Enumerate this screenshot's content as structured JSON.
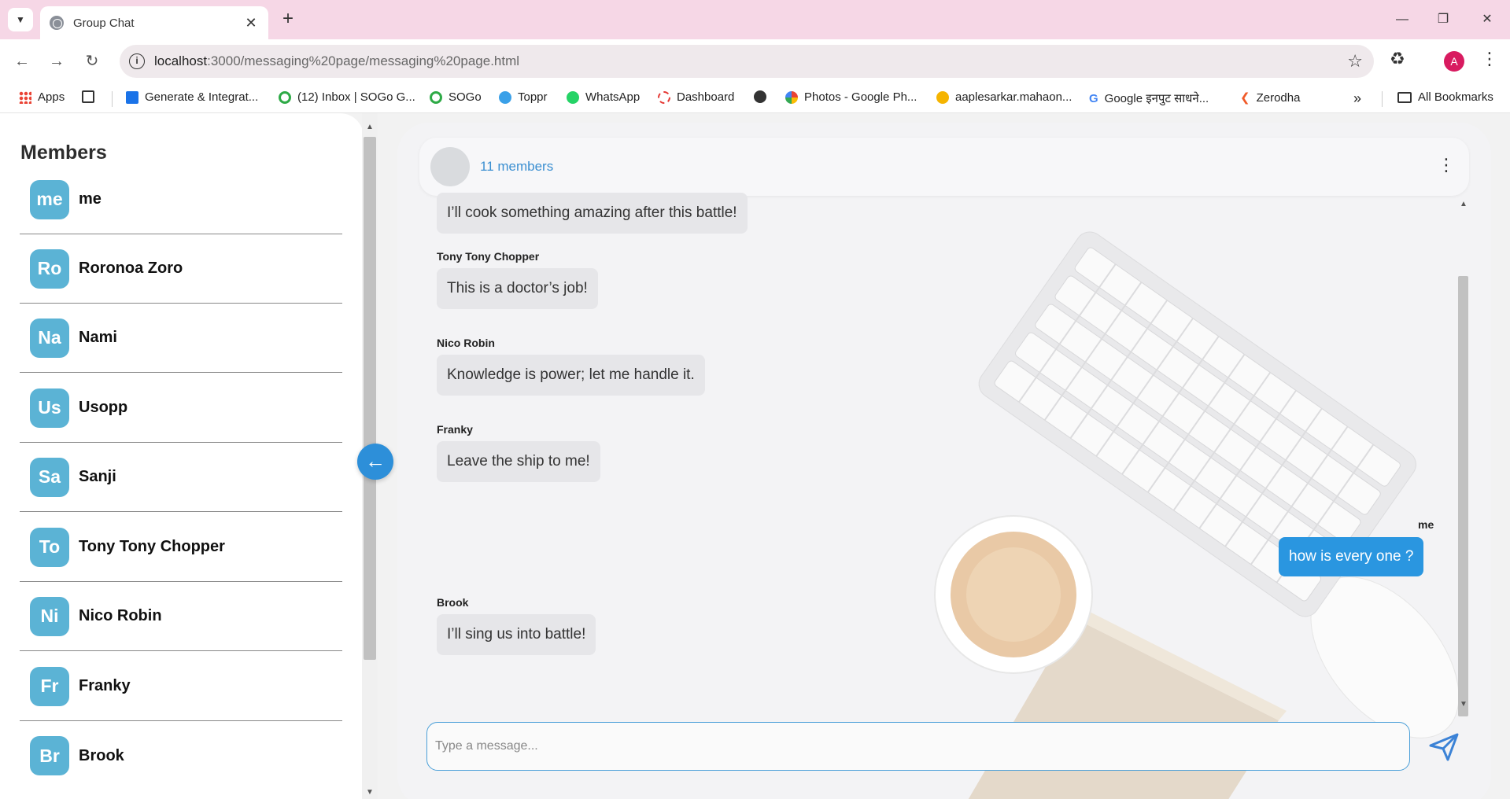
{
  "browser": {
    "tab_title": "Group Chat",
    "url_host": "localhost",
    "url_rest": ":3000/messaging%20page/messaging%20page.html",
    "profile_initial": "A",
    "bookmarks": [
      {
        "label": "Apps",
        "color": "#4285f4"
      },
      {
        "label": "Generate & Integrat...",
        "color": "#1a73e8"
      },
      {
        "label": "(12) Inbox | SOGo G...",
        "color": "#2eaa46"
      },
      {
        "label": "SOGo",
        "color": "#2eaa46"
      },
      {
        "label": "Toppr",
        "color": "#3aa0e8"
      },
      {
        "label": "WhatsApp",
        "color": "#25d366"
      },
      {
        "label": "Dashboard",
        "color": "#e53935"
      },
      {
        "label": "Photos - Google Ph...",
        "color": "#fbbc05"
      },
      {
        "label": "aaplesarkar.mahaon...",
        "color": "#f5b400"
      },
      {
        "label": "Google इनपुट साधने...",
        "color": "#4285f4"
      },
      {
        "label": "Zerodha",
        "color": "#f05a28"
      }
    ],
    "all_bookmarks_label": "All Bookmarks"
  },
  "sidebar": {
    "title": "Members",
    "members": [
      {
        "initials": "me",
        "name": "me"
      },
      {
        "initials": "Ro",
        "name": "Roronoa Zoro"
      },
      {
        "initials": "Na",
        "name": "Nami"
      },
      {
        "initials": "Us",
        "name": "Usopp"
      },
      {
        "initials": "Sa",
        "name": "Sanji"
      },
      {
        "initials": "To",
        "name": "Tony Tony Chopper"
      },
      {
        "initials": "Ni",
        "name": "Nico Robin"
      },
      {
        "initials": "Fr",
        "name": "Franky"
      },
      {
        "initials": "Br",
        "name": "Brook"
      }
    ]
  },
  "chat": {
    "member_count": "11 members",
    "messages": [
      {
        "sender": "",
        "text": "I’ll cook something amazing after this battle!",
        "mine": false
      },
      {
        "sender": "Tony Tony Chopper",
        "text": "This is a doctor’s job!",
        "mine": false
      },
      {
        "sender": "Nico Robin",
        "text": "Knowledge is power; let me handle it.",
        "mine": false
      },
      {
        "sender": "Franky",
        "text": "Leave the ship to me!",
        "mine": false
      },
      {
        "sender": "me",
        "text": "how is every one ?",
        "mine": true
      },
      {
        "sender": "Brook",
        "text": "I’ll sing us into battle!",
        "mine": false
      }
    ],
    "composer_placeholder": "Type a message..."
  },
  "colors": {
    "accent": "#2a96e0",
    "avatar_bg": "#5bb3d5",
    "tabstrip": "#f6d7e6"
  }
}
